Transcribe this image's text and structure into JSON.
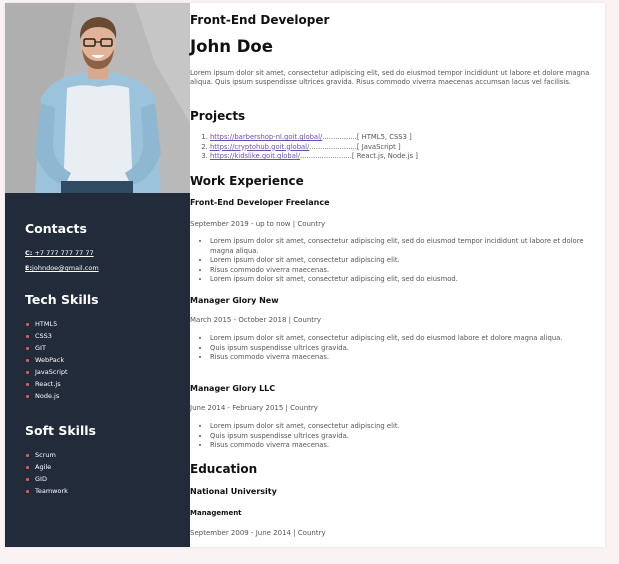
{
  "sidebar": {
    "contacts_title": "Contacts",
    "phone_label": "C:",
    "phone": "+7 777 777 77 77",
    "email_label": "E:",
    "email": "johndoe@gmail.com",
    "tech_title": "Tech Skills",
    "tech_skills": [
      "HTML5",
      "CSS3",
      "GIT",
      "WebPack",
      "JavaScript",
      "React.js",
      "Node.js"
    ],
    "soft_title": "Soft Skills",
    "soft_skills": [
      "Scrum",
      "Agile",
      "GID",
      "Teamwork"
    ]
  },
  "header": {
    "job_title": "Front-End Developer",
    "name": "John Doe",
    "about": "Lorem ipsum dolor sit amet, consectetur adipiscing elit, sed do eiusmod tempor incididunt ut labore et dolore magna aliqua. Quis ipsum suspendisse ultrices gravida. Risus commodo viverra maecenas accumsan lacus vel facilisis."
  },
  "projects": {
    "title": "Projects",
    "items": [
      {
        "link": "https://barbershop-nl.goit.global/",
        "dots": "................",
        "tech": "[ HTML5, CSS3 ]"
      },
      {
        "link": "https://cryptohub.goit.global/",
        "dots": "......................",
        "tech": "[ JavaScript ]"
      },
      {
        "link": "https://kidslike.goit.global/",
        "dots": "........................",
        "tech": "[ React.js, Node.js ]"
      }
    ]
  },
  "experience": {
    "title": "Work Experience",
    "jobs": [
      {
        "role": "Front-End Developer Freelance",
        "period": "September 2019 - up to now | Country",
        "bullets": [
          "Lorem ipsum dolor sit amet, consectetur adipiscing elit, sed do eiusmod tempor incididunt ut labore et dolore magna aliqua.",
          "Lorem ipsum dolor sit amet, consectetur adipiscing elit.",
          "Risus commodo viverra maecenas.",
          "Lorem ipsum dolor sit amet, consectetur adipiscing elit, sed do eiusmod."
        ]
      },
      {
        "role": "Manager Glory New",
        "period": "March 2015 - October 2018 | Country",
        "bullets": [
          "Lorem ipsum dolor sit amet, consectetur adipiscing elit, sed do eiusmod labore et dolore magna aliqua.",
          "Quis ipsum suspendisse ultrices gravida.",
          "Risus commodo viverra maecenas."
        ]
      },
      {
        "role": "Manager Glory LLC",
        "period": "June 2014 - February 2015 | Country",
        "bullets": [
          "Lorem ipsum dolor sit amet, consectetur adipiscing elit.",
          "Quis ipsum suspendisse ultrices gravida.",
          "Risus commodo viverra maecenas."
        ]
      }
    ]
  },
  "education": {
    "title": "Education",
    "school": "National University",
    "degree": "Management",
    "period": "September 2009 - June 2014 | Country"
  }
}
